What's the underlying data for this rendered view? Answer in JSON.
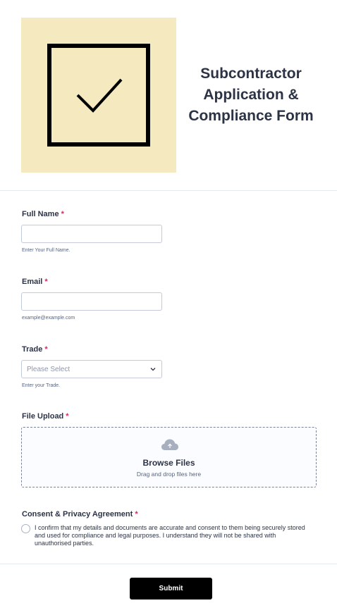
{
  "form": {
    "title_line1": "Subcontractor",
    "title_line2": "Application &",
    "title_line3": "Compliance Form",
    "logo_icon": "checkbox-check-icon",
    "logo_bg_color": "#f5e9bf"
  },
  "fields": {
    "full_name": {
      "label": "Full Name",
      "required_mark": "*",
      "value": "",
      "sublabel": "Enter Your Full Name."
    },
    "email": {
      "label": "Email",
      "required_mark": "*",
      "value": "",
      "sublabel": "example@example.com"
    },
    "trade": {
      "label": "Trade",
      "required_mark": "*",
      "placeholder": "Please Select",
      "sublabel": "Enter your Trade."
    },
    "file_upload": {
      "label": "File Upload",
      "required_mark": "*",
      "icon": "cloud-upload-icon",
      "browse_label": "Browse Files",
      "drag_hint": "Drag and drop files here"
    },
    "consent": {
      "label": "Consent & Privacy Agreement",
      "required_mark": "*",
      "text": "I confirm that my details and documents are accurate and consent to them being securely stored and used for compliance and legal purposes. I understand they will not be shared with unauthorised parties."
    }
  },
  "submit": {
    "label": "Submit",
    "color": "#000000"
  },
  "colors": {
    "required": "#e0245e",
    "text": "#2c3345"
  }
}
